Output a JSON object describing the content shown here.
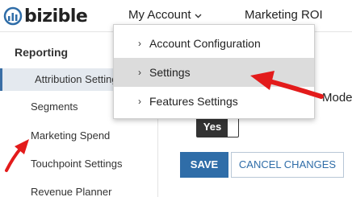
{
  "header": {
    "logo_text": "bizible",
    "nav": {
      "my_account": "My Account",
      "marketing_roi": "Marketing ROI"
    }
  },
  "dropdown": {
    "items": [
      {
        "label": "Account Configuration"
      },
      {
        "label": "Settings"
      },
      {
        "label": "Features Settings"
      }
    ]
  },
  "sidebar": {
    "heading": "Reporting",
    "items": [
      {
        "label": "Attribution Settings"
      },
      {
        "label": "Segments"
      },
      {
        "label": "Marketing Spend"
      },
      {
        "label": "Touchpoint Settings"
      },
      {
        "label": "Revenue Planner"
      }
    ]
  },
  "main": {
    "mode_label": "Mode",
    "toggle_value": "Yes",
    "save_label": "SAVE",
    "cancel_label": "CANCEL CHANGES"
  },
  "colors": {
    "accent": "#2f6da8",
    "annotation_arrow": "#e31b1b",
    "active_bg": "#e4e9ef"
  }
}
